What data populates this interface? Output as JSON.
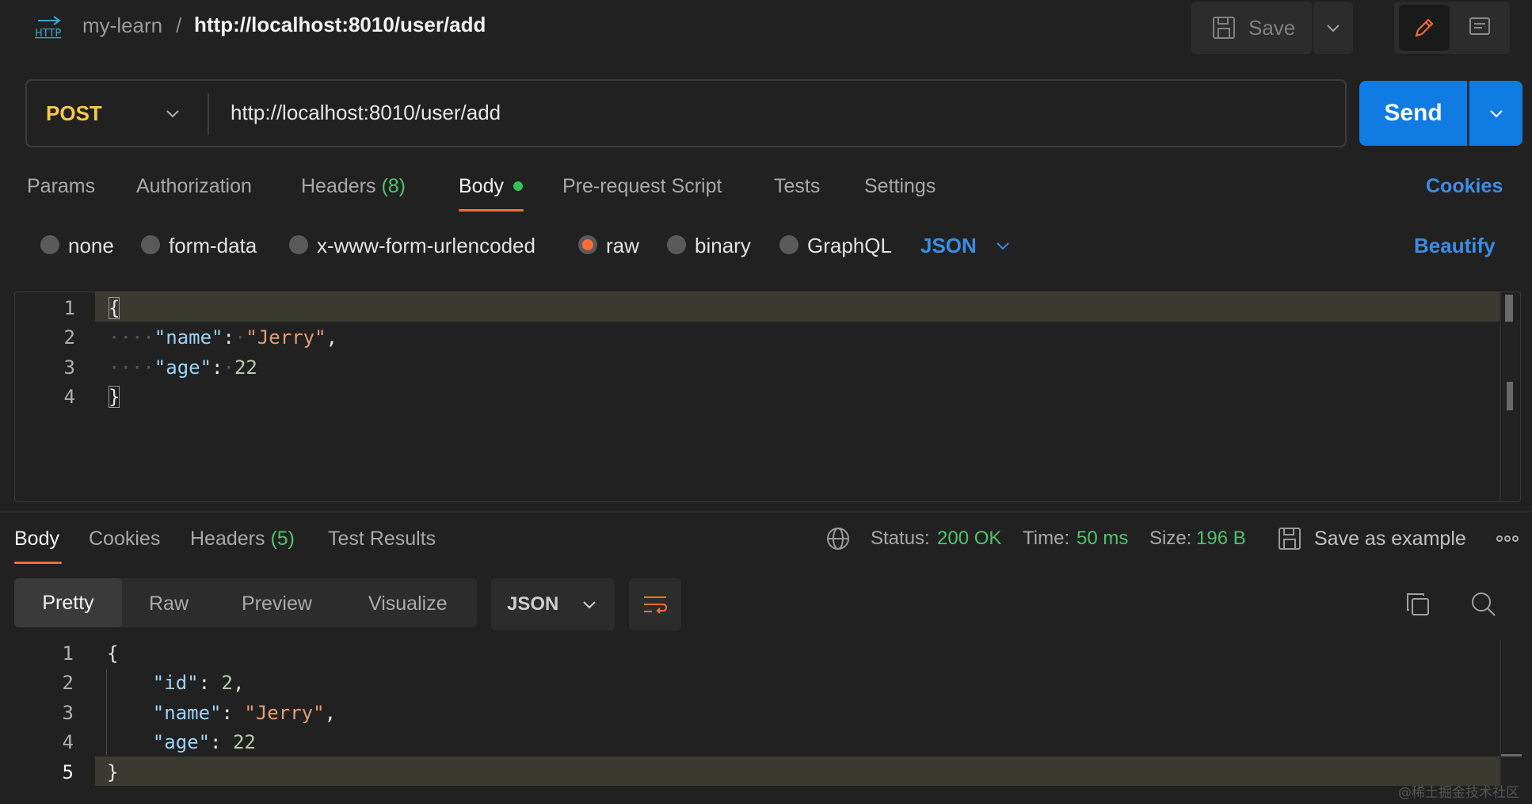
{
  "header": {
    "collection": "my-learn",
    "separator": "/",
    "request_name": "http://localhost:8010/user/add",
    "save_label": "Save"
  },
  "request": {
    "method": "POST",
    "url": "http://localhost:8010/user/add",
    "send_label": "Send"
  },
  "request_tabs": {
    "params": "Params",
    "authorization": "Authorization",
    "headers": "Headers",
    "headers_count": "(8)",
    "body": "Body",
    "pre_request": "Pre-request Script",
    "tests": "Tests",
    "settings": "Settings",
    "cookies": "Cookies"
  },
  "body_types": {
    "none": "none",
    "form_data": "form-data",
    "urlencoded": "x-www-form-urlencoded",
    "raw": "raw",
    "binary": "binary",
    "graphql": "GraphQL",
    "selected": "raw",
    "language": "JSON",
    "beautify": "Beautify"
  },
  "request_body": {
    "line_numbers": [
      "1",
      "2",
      "3",
      "4"
    ],
    "name_key": "\"name\"",
    "name_value": "\"Jerry\"",
    "age_key": "\"age\"",
    "age_value": "22"
  },
  "response_tabs": {
    "body": "Body",
    "cookies": "Cookies",
    "headers": "Headers",
    "headers_count": "(5)",
    "test_results": "Test Results"
  },
  "response_meta": {
    "status_label": "Status:",
    "status_value": "200 OK",
    "time_label": "Time:",
    "time_value": "50 ms",
    "size_label": "Size:",
    "size_value": "196 B",
    "save_example": "Save as example"
  },
  "response_view": {
    "pretty": "Pretty",
    "raw": "Raw",
    "preview": "Preview",
    "visualize": "Visualize",
    "language": "JSON"
  },
  "response_body": {
    "line_numbers": [
      "1",
      "2",
      "3",
      "4",
      "5"
    ],
    "id_key": "\"id\"",
    "id_value": "2",
    "name_key": "\"name\"",
    "name_value": "\"Jerry\"",
    "age_key": "\"age\"",
    "age_value": "22"
  },
  "watermark": "@稀土掘金技术社区",
  "colors": {
    "accent_orange": "#ff6c37",
    "send_blue": "#0f7be3",
    "link_blue": "#3a8de6",
    "success_green": "#4fc26b",
    "method_yellow": "#f7c948"
  }
}
